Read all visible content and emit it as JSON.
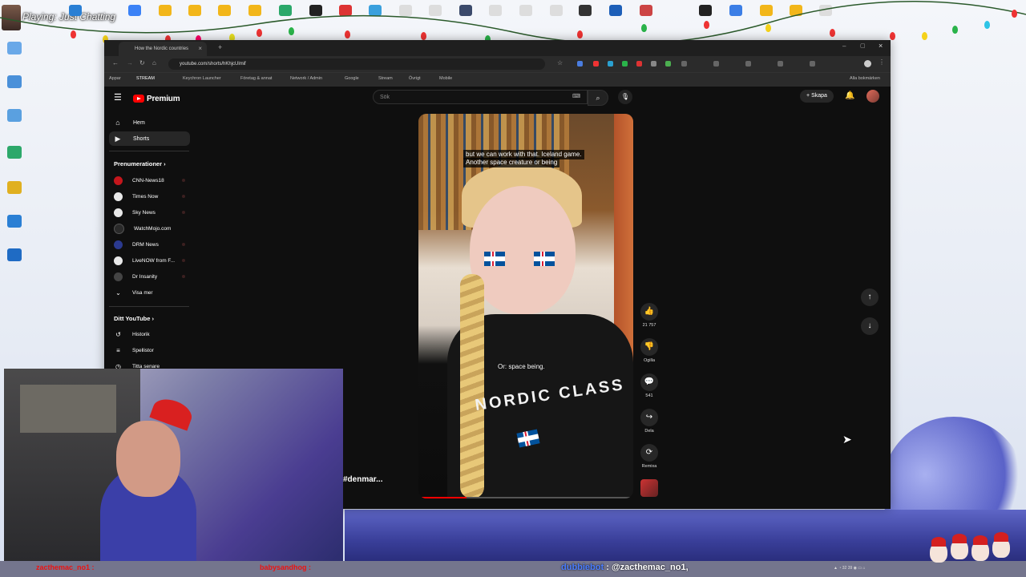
{
  "stream": {
    "title": "Playing: Just Chatting"
  },
  "browser": {
    "tab_title": "How the Nordic countries",
    "url": "youtube.com/shorts/hKhjcUlmif",
    "bookmarks": [
      "Appar",
      "STREAM",
      "Keychron Launcher",
      "Företag & annat",
      "Network / Admin",
      "Google",
      "Stream",
      "Övrigt",
      "Mobile",
      "Alla bokmärken"
    ]
  },
  "youtube": {
    "logo": "Premium",
    "search_placeholder": "Sök",
    "create_label": "Skapa",
    "nav": [
      {
        "label": "Hem",
        "icon": "home-icon"
      },
      {
        "label": "Shorts",
        "icon": "shorts-icon"
      }
    ],
    "subscriptions_title": "Prenumerationer",
    "subscriptions": [
      {
        "label": "CNN-News18",
        "color": "#c4161c"
      },
      {
        "label": "Times Now",
        "color": "#e8e8e8"
      },
      {
        "label": "Sky News",
        "color": "#e8e8e8"
      },
      {
        "label": "WatchMojo.com",
        "color": "#2a2a2a"
      },
      {
        "label": "DRM News",
        "color": "#2b3a8f"
      },
      {
        "label": "LiveNOW from F...",
        "color": "#e8e8e8"
      },
      {
        "label": "Dr Insanity",
        "color": "#444444"
      }
    ],
    "show_more": "Visa mer",
    "you_title": "Ditt YouTube",
    "you_items": [
      {
        "label": "Historik"
      },
      {
        "label": "Spellistor"
      },
      {
        "label": "Titta senare"
      }
    ]
  },
  "video": {
    "caption_top_line1": "but we can work with that. Iceland game.",
    "caption_top_line2": "Another space creature or being",
    "caption_mid": "Or: space being.",
    "shirt_text": "NORDIC CLASS",
    "hashtag": "#denmar..."
  },
  "actions": {
    "likes": "21 757",
    "dislike": "Ogilla",
    "comments": "541",
    "share": "Dela",
    "remix": "Remixa"
  },
  "chat": {
    "msg1": "zacthemac_no1 :",
    "msg2": "babysandhog :",
    "user": "dubbiebot",
    "msg3": ": @zacthemac_no1,"
  },
  "colors": {
    "accent": "#ff0000",
    "page_bg": "#0f0f0f"
  }
}
